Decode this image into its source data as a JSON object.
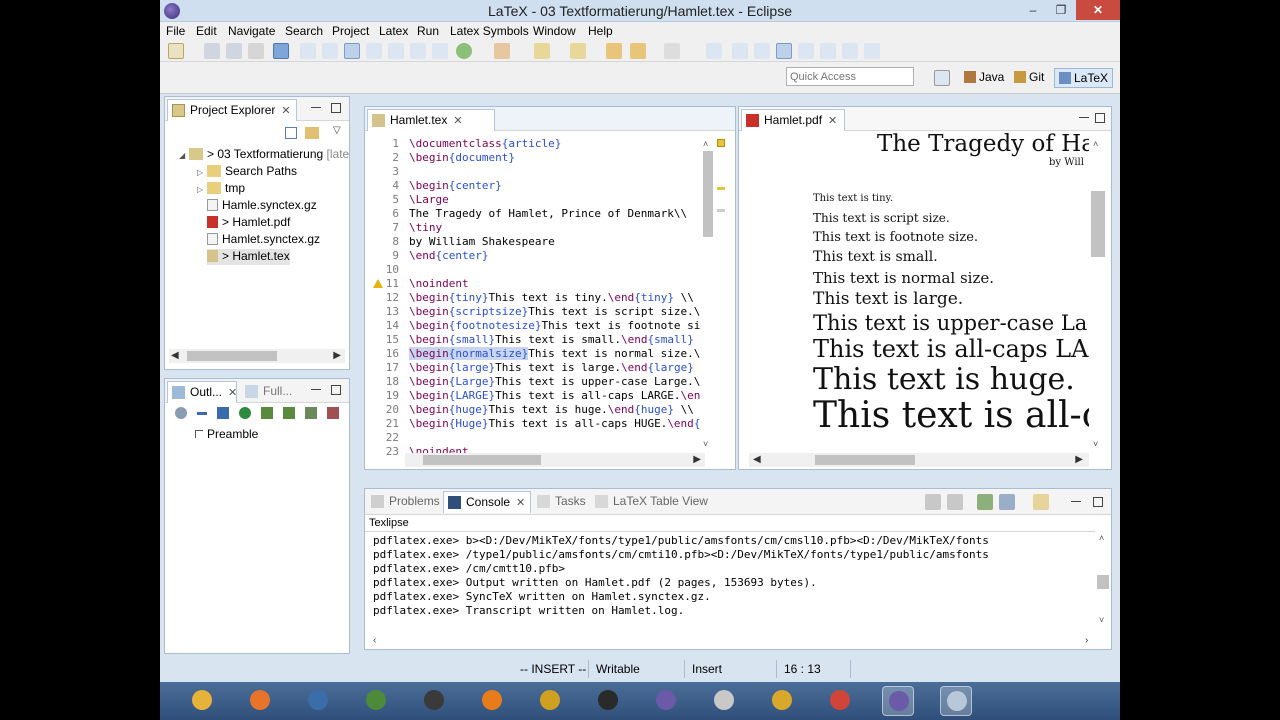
{
  "window": {
    "title": "LaTeX - 03 Textformatierung/Hamlet.tex - Eclipse",
    "min": "–",
    "max": "❐",
    "close": "✕"
  },
  "menu": [
    "File",
    "Edit",
    "Navigate",
    "Search",
    "Project",
    "Latex",
    "Run",
    "Latex Symbols",
    "Window",
    "Help"
  ],
  "quick_access": {
    "placeholder": "Quick Access"
  },
  "perspectives": [
    "Java",
    "Git",
    "LaTeX"
  ],
  "project_explorer": {
    "title": "Project Explorer",
    "items": [
      {
        "label": "> 03 Textformatierung",
        "suffix": "[late",
        "icon": "project-icon"
      },
      {
        "label": "Search Paths",
        "icon": "folder-icon"
      },
      {
        "label": "tmp",
        "icon": "folder-icon"
      },
      {
        "label": "Hamle.synctex.gz",
        "icon": "file-icon"
      },
      {
        "label": "> Hamlet.pdf",
        "icon": "pdf-file-icon"
      },
      {
        "label": "Hamlet.synctex.gz",
        "icon": "file-icon"
      },
      {
        "label": "> Hamlet.tex",
        "icon": "tex-file-icon"
      }
    ]
  },
  "outline": {
    "tab1": "Outl...",
    "tab2": "Full...",
    "items": [
      "Preamble"
    ]
  },
  "editor": {
    "tab": "Hamlet.tex",
    "lines": [
      {
        "n": "1",
        "t": "\\documentclass{article}"
      },
      {
        "n": "2",
        "t": "\\begin{document}"
      },
      {
        "n": "3",
        "t": ""
      },
      {
        "n": "4",
        "t": "\\begin{center}"
      },
      {
        "n": "5",
        "t": "\\Large"
      },
      {
        "n": "6",
        "t": "The Tragedy of Hamlet, Prince of Denmark\\\\"
      },
      {
        "n": "7",
        "t": "\\tiny"
      },
      {
        "n": "8",
        "t": "by William Shakespeare"
      },
      {
        "n": "9",
        "t": "\\end{center}"
      },
      {
        "n": "10",
        "t": ""
      },
      {
        "n": "11",
        "t": "\\noindent"
      },
      {
        "n": "12",
        "t": "\\begin{tiny}This text is tiny.\\end{tiny} \\\\"
      },
      {
        "n": "13",
        "t": "\\begin{scriptsize}This text is script size.\\"
      },
      {
        "n": "14",
        "t": "\\begin{footnotesize}This text is footnote si"
      },
      {
        "n": "15",
        "t": "\\begin{small}This text is small.\\end{small}"
      },
      {
        "n": "16",
        "t": "\\begin{normalsize}This text is normal size.\\"
      },
      {
        "n": "17",
        "t": "\\begin{large}This text is large.\\end{large}"
      },
      {
        "n": "18",
        "t": "\\begin{Large}This text is upper-case Large.\\"
      },
      {
        "n": "19",
        "t": "\\begin{LARGE}This text is all-caps LARGE.\\en"
      },
      {
        "n": "20",
        "t": "\\begin{huge}This text is huge.\\end{huge} \\\\"
      },
      {
        "n": "21",
        "t": "\\begin{Huge}This text is all-caps HUGE.\\end{"
      },
      {
        "n": "22",
        "t": ""
      },
      {
        "n": "23",
        "t": "\\noindent"
      }
    ]
  },
  "pdf_viewer": {
    "tab": "Hamlet.pdf",
    "title": "The Tragedy of Har",
    "byline": "by Will",
    "lines": [
      "This text is tiny.",
      "This text is script size.",
      "This text is footnote size.",
      "This text is small.",
      "This text is normal size.",
      "This text is large.",
      "This text is upper-case La",
      "This text is all-caps LA",
      "This text is huge.",
      "This text is all-c"
    ]
  },
  "bottom_panel": {
    "tabs": [
      "Problems",
      "Console",
      "Tasks",
      "LaTeX Table View"
    ],
    "console_name": "Texlipse",
    "lines": [
      "pdflatex.exe> b><D:/Dev/MikTeX/fonts/type1/public/amsfonts/cm/cmsl10.pfb><D:/Dev/MikTeX/fonts",
      "pdflatex.exe> /type1/public/amsfonts/cm/cmti10.pfb><D:/Dev/MikTeX/fonts/type1/public/amsfonts",
      "pdflatex.exe> /cm/cmtt10.pfb>",
      "pdflatex.exe> Output written on Hamlet.pdf (2 pages, 153693 bytes).",
      "pdflatex.exe> SyncTeX written on Hamlet.synctex.gz.",
      "pdflatex.exe> Transcript written on Hamlet.log."
    ]
  },
  "status": {
    "mode": "-- INSERT --",
    "writable": "Writable",
    "insert": "Insert",
    "position": "16 : 13"
  },
  "colors": {
    "keyword": "#7f0055",
    "brace": "#2a4fd0",
    "selection": "#c7d6ee",
    "taskbar": "#3a5c88"
  },
  "taskbar_apps": [
    "file-explorer-icon",
    "firefox-icon",
    "thunderbird-icon",
    "vim-icon",
    "calculator-icon",
    "vlc-icon",
    "inkscape-icon",
    "network-icon",
    "eclipse-icon",
    "virtualbox-icon",
    "chrome-icon",
    "powerpoint-icon",
    "eclipse-icon",
    "screen-icon"
  ]
}
